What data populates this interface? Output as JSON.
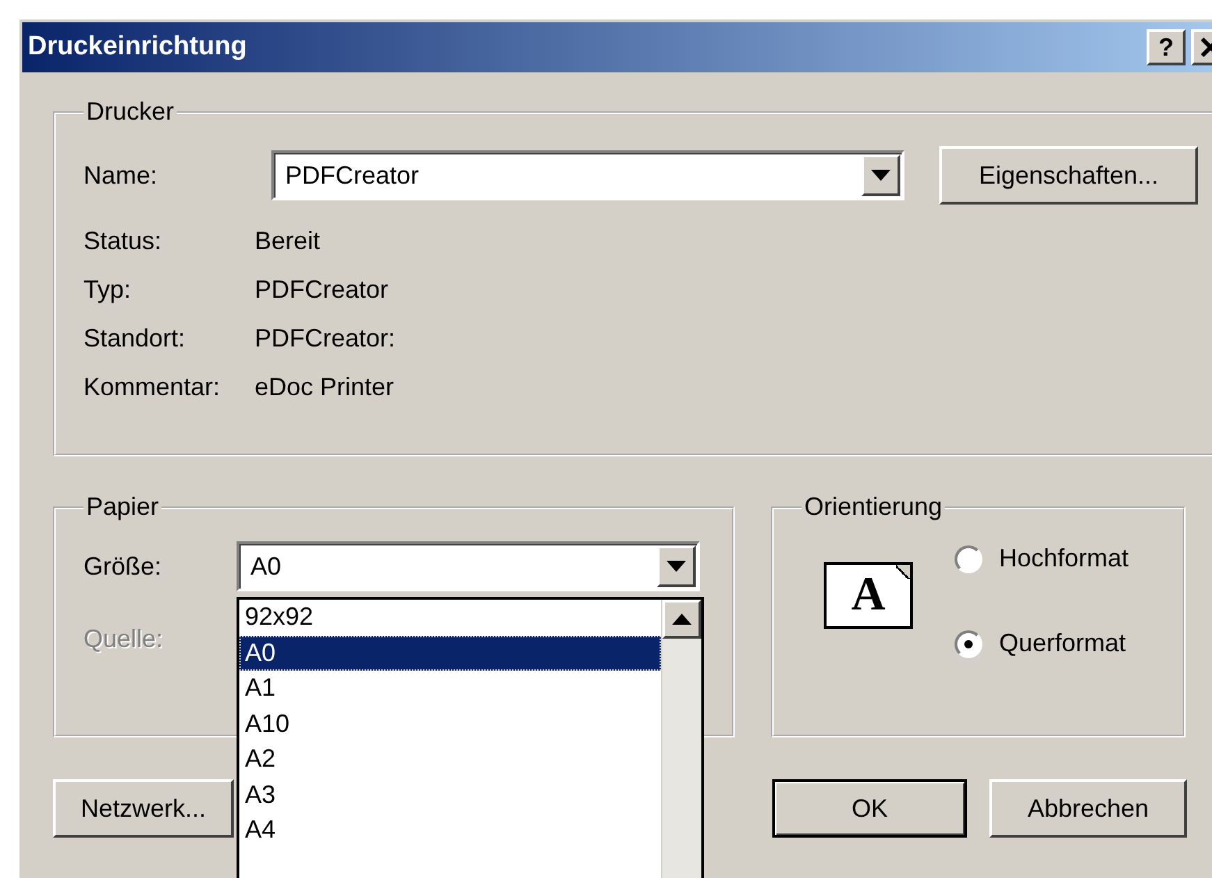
{
  "window": {
    "title": "Druckeinrichtung",
    "help": "?"
  },
  "printer": {
    "legend": "Drucker",
    "name_label": "Name:",
    "name_value": "PDFCreator",
    "properties_button": "Eigenschaften...",
    "info": [
      {
        "label": "Status:",
        "value": "Bereit"
      },
      {
        "label": "Typ:",
        "value": "PDFCreator"
      },
      {
        "label": "Standort:",
        "value": "PDFCreator:"
      },
      {
        "label": "Kommentar:",
        "value": "eDoc Printer"
      }
    ]
  },
  "paper": {
    "legend": "Papier",
    "size_label": "Größe:",
    "size_value": "A0",
    "source_label": "Quelle:",
    "source_disabled": true,
    "size_list": [
      {
        "label": "92x92",
        "selected": false
      },
      {
        "label": "A0",
        "selected": true
      },
      {
        "label": "A1",
        "selected": false
      },
      {
        "label": "A10",
        "selected": false
      },
      {
        "label": "A2",
        "selected": false
      },
      {
        "label": "A3",
        "selected": false
      },
      {
        "label": "A4",
        "selected": false
      }
    ]
  },
  "orientation": {
    "legend": "Orientierung",
    "preview_letter": "A",
    "options": [
      {
        "label": "Hochformat",
        "selected": false
      },
      {
        "label": "Querformat",
        "selected": true
      }
    ]
  },
  "network_button": "Netzwerk...",
  "ok_button": "OK",
  "cancel_button": "Abbrechen"
}
